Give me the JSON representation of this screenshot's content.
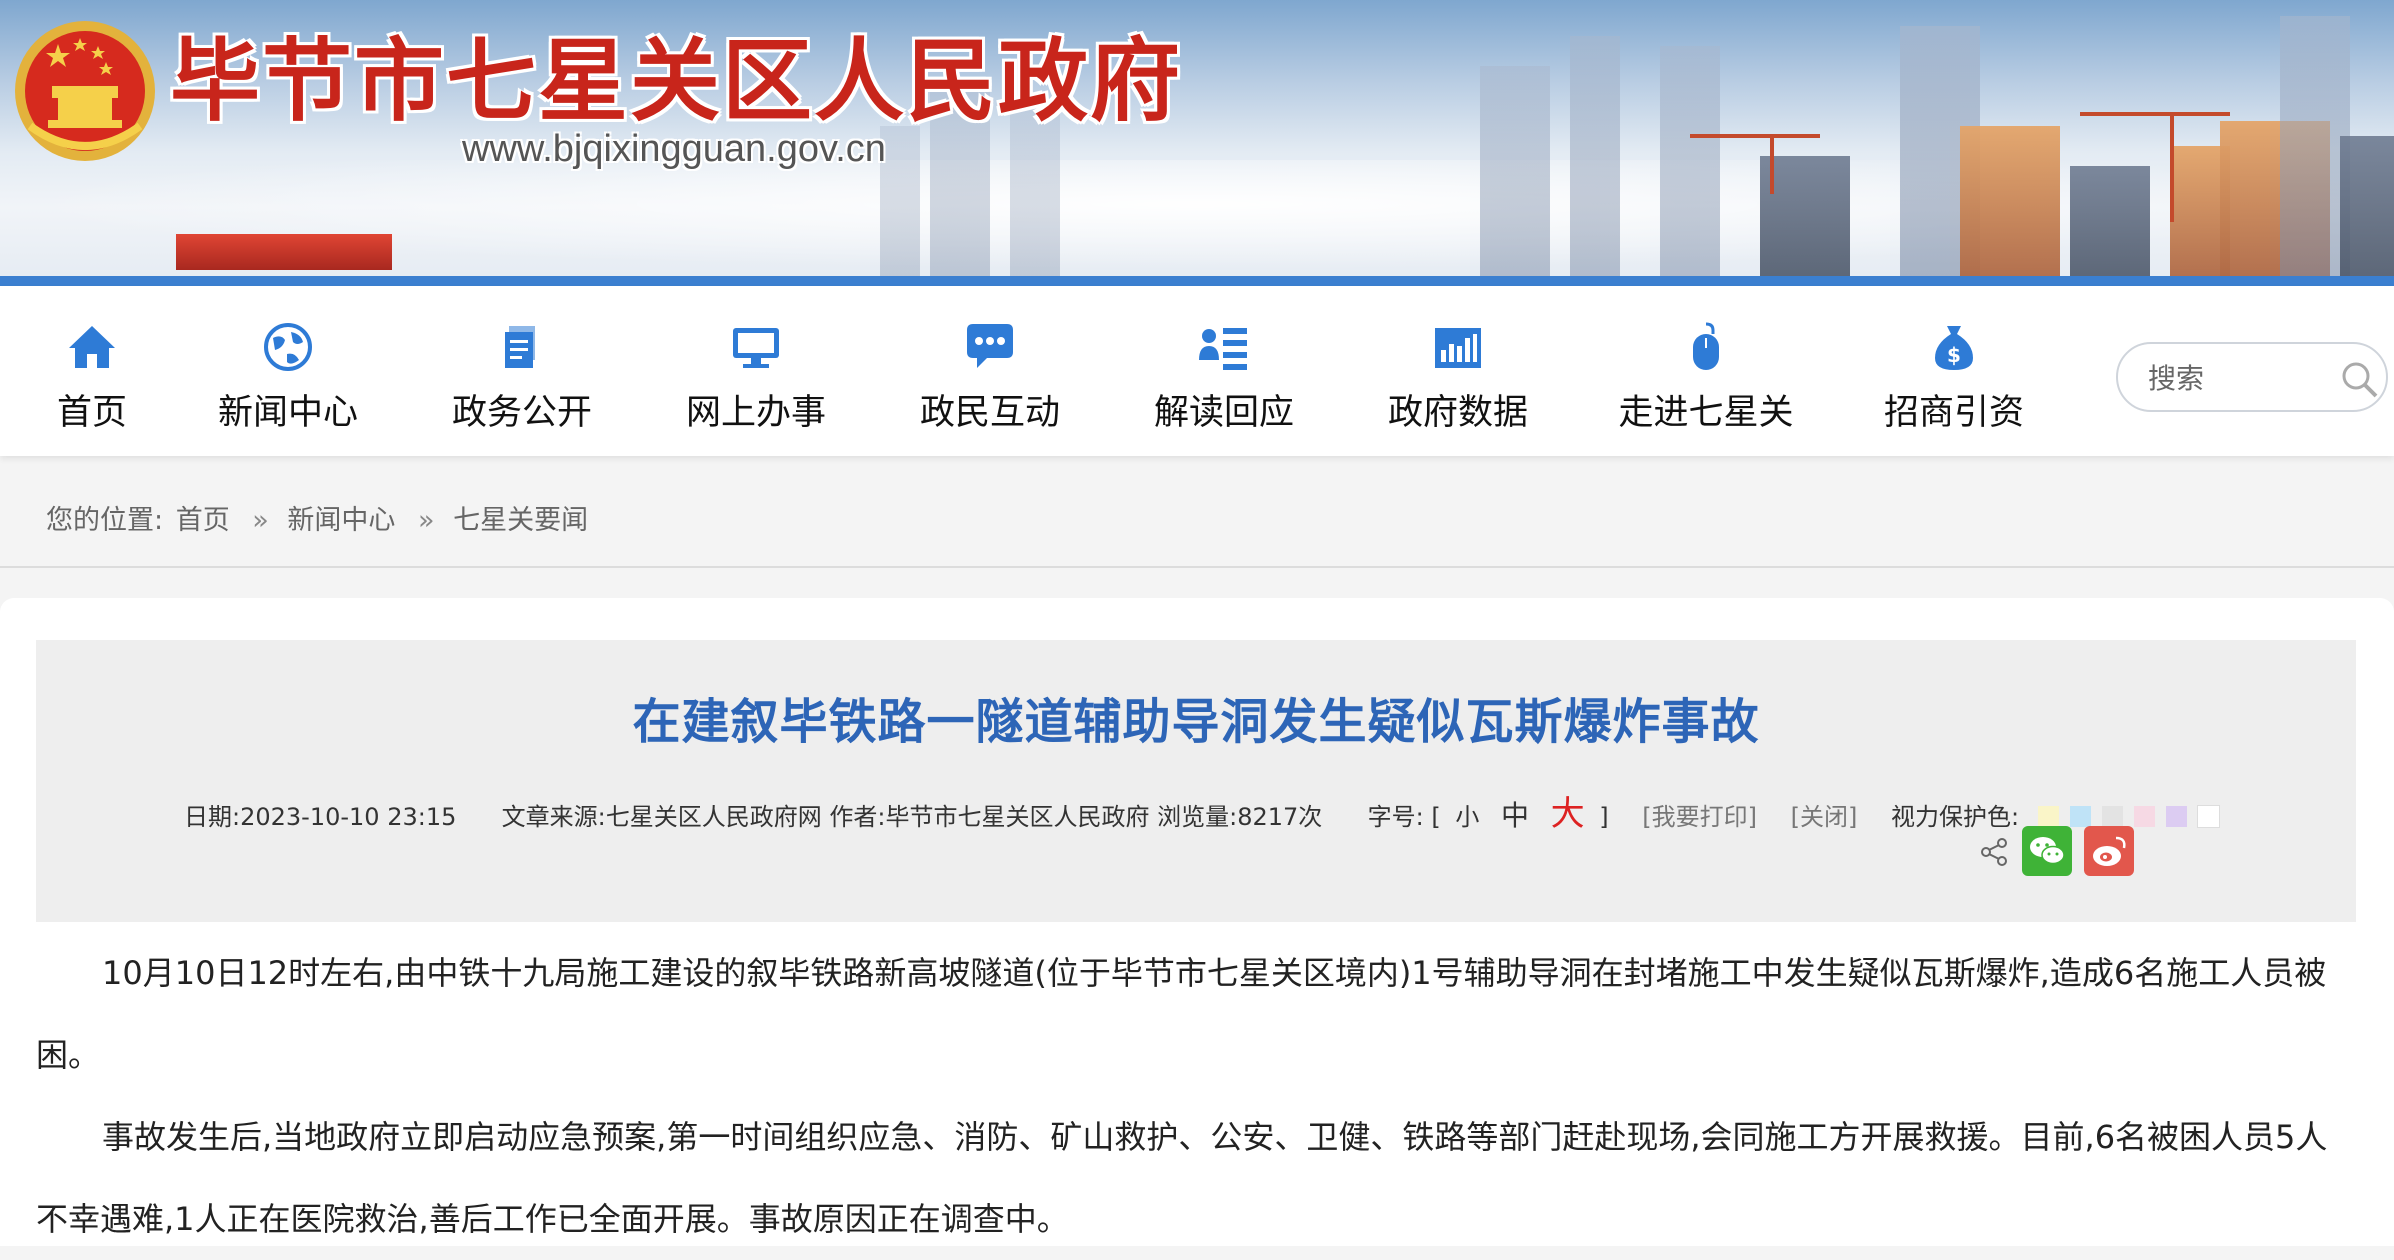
{
  "header": {
    "site_title": "毕节市七星关区人民政府",
    "site_url": "www.bjqixingguan.gov.cn"
  },
  "nav": {
    "items": [
      {
        "label": "首页",
        "icon": "home-icon"
      },
      {
        "label": "新闻中心",
        "icon": "globe-icon"
      },
      {
        "label": "政务公开",
        "icon": "document-icon"
      },
      {
        "label": "网上办事",
        "icon": "monitor-icon"
      },
      {
        "label": "政民互动",
        "icon": "chat-bubble-icon"
      },
      {
        "label": "解读回应",
        "icon": "user-list-icon"
      },
      {
        "label": "政府数据",
        "icon": "bar-chart-icon"
      },
      {
        "label": "走进七星关",
        "icon": "mouse-icon"
      },
      {
        "label": "招商引资",
        "icon": "money-bag-icon"
      }
    ],
    "search_placeholder": "搜索"
  },
  "breadcrumb": {
    "prefix": "您的位置:",
    "items": [
      "首页",
      "新闻中心",
      "七星关要闻"
    ],
    "separator": "»"
  },
  "article": {
    "title": "在建叙毕铁路一隧道辅助导洞发生疑似瓦斯爆炸事故",
    "meta": {
      "date_label": "日期:",
      "date": "2023-10-10 23:15",
      "source_label": "文章来源:",
      "source": "七星关区人民政府网",
      "author_label": "作者:",
      "author": "毕节市七星关区人民政府",
      "views_label": "浏览量:",
      "views": "8217次",
      "fontsize_label": "字号:",
      "bracket_open": "[",
      "bracket_close": "]",
      "font_small": "小",
      "font_medium": "中",
      "font_large": "大",
      "print": "[我要打印]",
      "close": "[关闭]",
      "eye_color_label": "视力保护色:"
    },
    "eye_colors": [
      "#faf5c8",
      "#bfe3f7",
      "#e3e3e3",
      "#f6d9e4",
      "#dcccf2",
      "#ffffff"
    ],
    "paragraphs": [
      "10月10日12时左右,由中铁十九局施工建设的叙毕铁路新高坡隧道(位于毕节市七星关区境内)1号辅助导洞在封堵施工中发生疑似瓦斯爆炸,造成6名施工人员被困。",
      "事故发生后,当地政府立即启动应急预案,第一时间组织应急、消防、矿山救护、公安、卫健、铁路等部门赶赴现场,会同施工方开展救援。目前,6名被困人员5人不幸遇难,1人正在医院救治,善后工作已全面开展。事故原因正在调查中。"
    ]
  },
  "colors": {
    "title_blue": "#2d65b7",
    "site_red": "#c8251b",
    "nav_icon_blue": "#2e7bd6",
    "accent_bar": "#3b7fd0"
  }
}
